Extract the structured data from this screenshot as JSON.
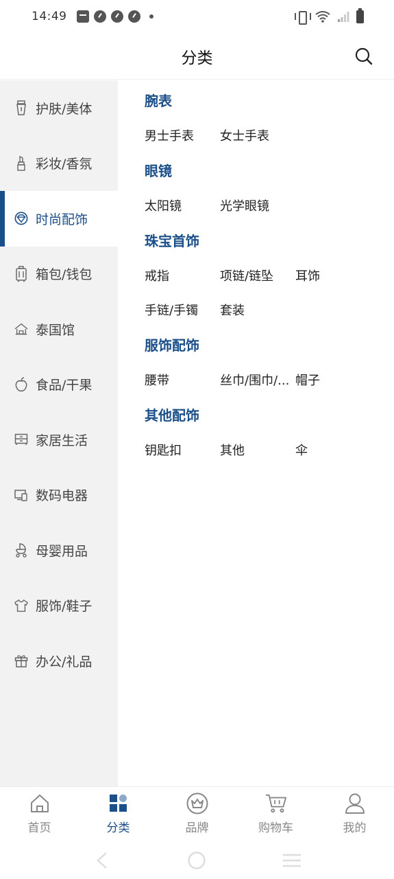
{
  "status_bar": {
    "time": "14:49",
    "icons": [
      "bag-notification-icon",
      "speed-app-icon",
      "speed-app-icon",
      "speed-app-icon",
      "more-dot-icon",
      "vibrate-icon",
      "wifi-icon",
      "signal-icon",
      "battery-icon"
    ]
  },
  "header": {
    "title": "分类",
    "search_icon": "search-icon"
  },
  "sidebar": {
    "items": [
      {
        "label": "护肤/美体",
        "icon": "lotion-icon",
        "active": false
      },
      {
        "label": "彩妆/香氛",
        "icon": "lipstick-icon",
        "active": false
      },
      {
        "label": "时尚配饰",
        "icon": "diamond-icon",
        "active": true
      },
      {
        "label": "箱包/钱包",
        "icon": "luggage-icon",
        "active": false
      },
      {
        "label": "泰国馆",
        "icon": "temple-icon",
        "active": false
      },
      {
        "label": "食品/干果",
        "icon": "fruit-icon",
        "active": false
      },
      {
        "label": "家居生活",
        "icon": "cabinet-icon",
        "active": false
      },
      {
        "label": "数码电器",
        "icon": "devices-icon",
        "active": false
      },
      {
        "label": "母婴用品",
        "icon": "stroller-icon",
        "active": false
      },
      {
        "label": "服饰/鞋子",
        "icon": "shirt-icon",
        "active": false
      },
      {
        "label": "办公/礼品",
        "icon": "gift-icon",
        "active": false
      }
    ],
    "active_color": "#1b4f8a"
  },
  "content": {
    "sections": [
      {
        "title": "腕表",
        "items": [
          "男士手表",
          "女士手表"
        ]
      },
      {
        "title": "眼镜",
        "items": [
          "太阳镜",
          "光学眼镜"
        ]
      },
      {
        "title": "珠宝首饰",
        "items": [
          "戒指",
          "项链/链坠",
          "耳饰",
          "手链/手镯",
          "套装"
        ]
      },
      {
        "title": "服饰配饰",
        "items": [
          "腰带",
          "丝巾/围巾/...",
          "帽子"
        ]
      },
      {
        "title": "其他配饰",
        "items": [
          "钥匙扣",
          "其他",
          "伞"
        ]
      }
    ]
  },
  "tabbar": {
    "tabs": [
      {
        "label": "首页",
        "icon": "home-icon",
        "active": false
      },
      {
        "label": "分类",
        "icon": "category-icon",
        "active": true
      },
      {
        "label": "品牌",
        "icon": "crown-icon",
        "active": false
      },
      {
        "label": "购物车",
        "icon": "cart-icon",
        "active": false
      },
      {
        "label": "我的",
        "icon": "user-icon",
        "active": false
      }
    ]
  },
  "system_nav": {
    "buttons": [
      "back-icon",
      "home-circle-icon",
      "menu-icon"
    ]
  },
  "colors": {
    "accent": "#1b4f8a",
    "sidebar_bg": "#f2f2f2",
    "inactive_text": "#888888"
  }
}
